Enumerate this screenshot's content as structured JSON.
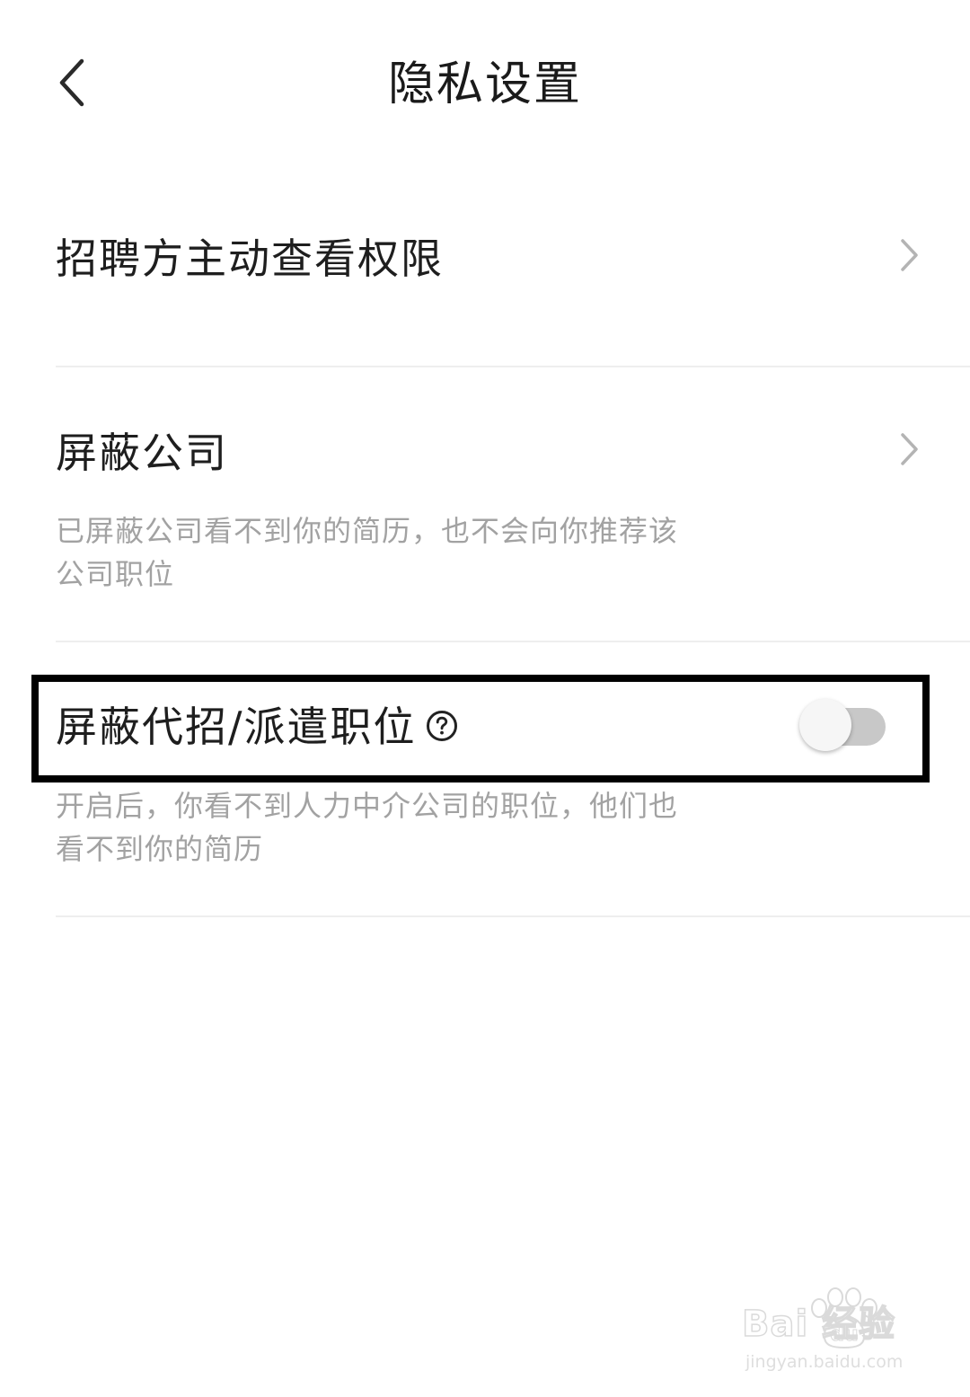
{
  "header": {
    "title": "隐私设置",
    "back_icon": "chevron-left-icon"
  },
  "settings": [
    {
      "title": "招聘方主动查看权限",
      "type": "link",
      "icon": "chevron-right-icon"
    },
    {
      "title": "屏蔽公司",
      "description": "已屏蔽公司看不到你的简历，也不会向你推荐该公司职位",
      "type": "link",
      "icon": "chevron-right-icon"
    },
    {
      "title": "屏蔽代招/派遣职位",
      "description": "开启后，你看不到人力中介公司的职位，他们也看不到你的简历",
      "type": "toggle",
      "toggle_on": false,
      "help_icon": "question-circle-icon"
    }
  ],
  "watermark": {
    "brand": "Bai  经验",
    "url": "jingyan.baidu.com",
    "logo_text": "du"
  },
  "colors": {
    "text_primary": "#1e1e1e",
    "text_secondary": "#a2a2a2",
    "divider": "#eeeeee",
    "toggle_track_off": "#c8c8c8",
    "highlight_border": "#000000"
  }
}
